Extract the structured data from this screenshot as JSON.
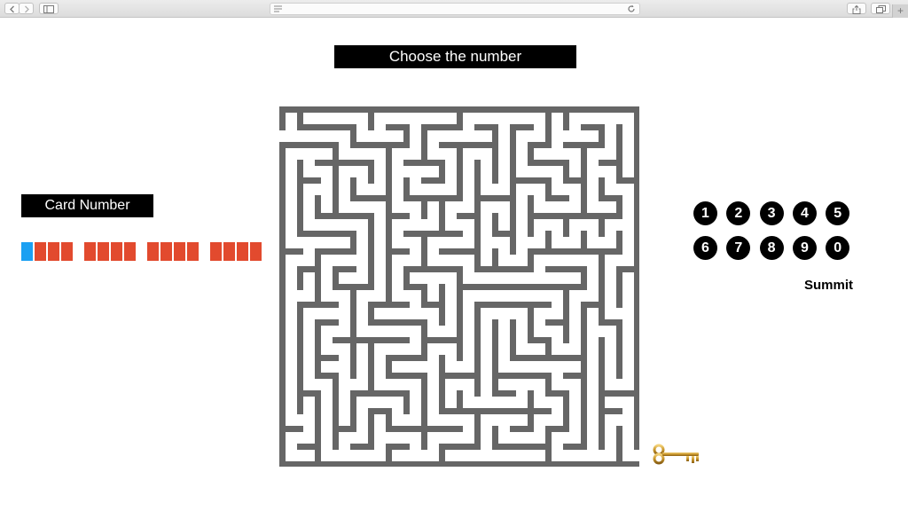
{
  "browser": {
    "back_icon": "chevron-left-icon",
    "forward_icon": "chevron-right-icon",
    "sidebar_icon": "sidebar-icon",
    "reader_icon": "reader-lines-icon",
    "reload_icon": "reload-icon",
    "share_icon": "share-icon",
    "tabs_icon": "tabs-icon",
    "new_tab_label": "+"
  },
  "header": {
    "title": "Choose the number"
  },
  "card": {
    "label": "Card Number",
    "digit_count": 16,
    "active_index": 0,
    "active_color": "#1ba0f2",
    "empty_color": "#e24a2e"
  },
  "maze": {
    "wall_color": "#666666",
    "background": "#ffffff"
  },
  "keypad": {
    "keys": [
      "1",
      "2",
      "3",
      "4",
      "5",
      "6",
      "7",
      "8",
      "9",
      "0"
    ],
    "submit_label": "Summit"
  },
  "goal": {
    "icon": "golden-key-icon",
    "color": "#c9962b"
  }
}
